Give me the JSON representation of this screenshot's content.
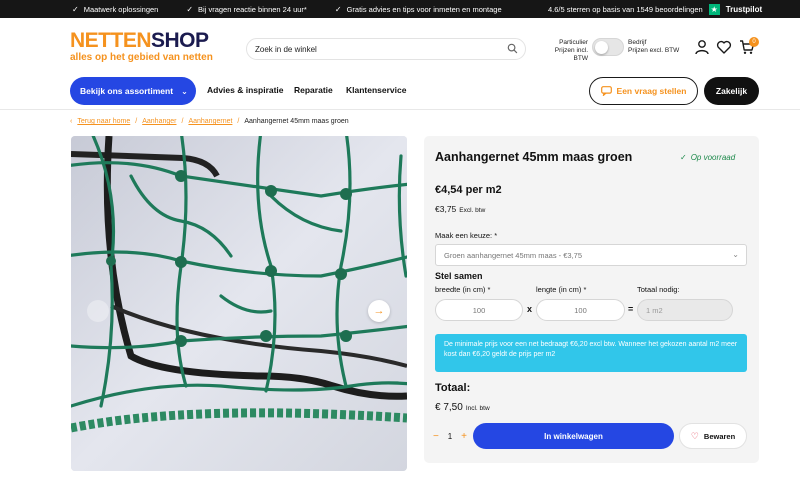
{
  "topbar": {
    "usps": [
      "Maatwerk oplossingen",
      "Bij vragen reactie binnen 24 uur*",
      "Gratis advies en tips voor inmeten en montage"
    ],
    "rating_text": "4.6/5 sterren op basis van 1549 beoordelingen",
    "trustpilot": "Trustpilot",
    "trustpilot_color": "#00b67a"
  },
  "header": {
    "logo_part1": "NETTEN",
    "logo_part2": "SHOP",
    "logo_tagline": "alles op het gebied van netten",
    "search_placeholder": "Zoek in de winkel",
    "vat_left_1": "Particulier",
    "vat_left_2": "Prijzen incl. BTW",
    "vat_right_1": "Bedrijf",
    "vat_right_2": "Prijzen excl. BTW",
    "cart_count": "0",
    "icons": [
      "search-icon",
      "user-icon",
      "heart-icon",
      "cart-icon"
    ],
    "accent_color": "#f5921e",
    "primary_color": "#2547e3"
  },
  "nav": {
    "assortment_label": "Bekijk ons assortiment",
    "links": [
      "Advies & inspiratie",
      "Reparatie",
      "Klantenservice"
    ],
    "ask_label": "Een vraag stellen",
    "business_label": "Zakelijk"
  },
  "breadcrumb": {
    "back": "Terug naar home",
    "items": [
      "Aanhanger",
      "Aanhangernet"
    ],
    "current": "Aanhangernet 45mm maas groen"
  },
  "product": {
    "title": "Aanhangernet 45mm maas groen",
    "stock": "Op voorraad",
    "price_incl": "€4,54",
    "price_unit": "per m2",
    "price_excl": "€3,75",
    "price_excl_note": "Excl. btw",
    "choice_label": "Maak een keuze: *",
    "choice_value": "Groen aanhangernet 45mm maas - €3,75",
    "compose_heading": "Stel samen",
    "width_label": "breedte (in cm) *",
    "length_label": "lengte (in cm) *",
    "total_label": "Totaal nodig:",
    "width_value": "100",
    "length_value": "100",
    "total_value": "1 m2",
    "times_sign": "x",
    "equals_sign": "=",
    "info_text": "De minimale prijs voor een net bedraagt €6,20 excl btw. Wanneer het gekozen aantal m2 meer kost dan €6,20 geldt de prijs per m2",
    "total_heading": "Totaal:",
    "total_price": "€ 7,50",
    "total_note": "Incl. btw",
    "quantity": "1",
    "qty_minus": "−",
    "qty_plus": "+",
    "add_to_cart": "In winkelwagen",
    "save_label": "Bewaren"
  }
}
